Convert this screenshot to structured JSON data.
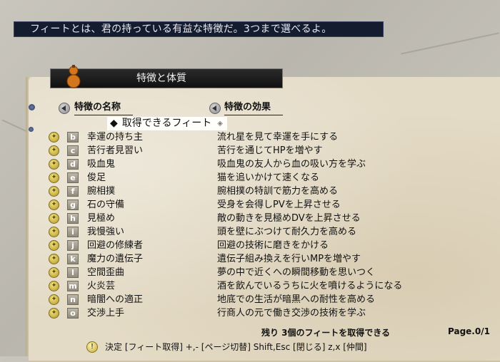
{
  "hint": "フィートとは、君の持っている有益な特徴だ。3つまで選べるよ。",
  "window_title": "特徴と体質",
  "columns": {
    "name": "特徴の名称",
    "effect": "特徴の効果"
  },
  "section_label": "取得できるフィート",
  "feats": [
    {
      "key": "b",
      "name": "幸運の持ち主",
      "effect": "流れ星を見て幸運を手にする"
    },
    {
      "key": "c",
      "name": "苦行者見習い",
      "effect": "苦行を通じてHPを増やす"
    },
    {
      "key": "d",
      "name": "吸血鬼",
      "effect": "吸血鬼の友人から血の吸い方を学ぶ"
    },
    {
      "key": "e",
      "name": "俊足",
      "effect": "猫を追いかけて速くなる"
    },
    {
      "key": "f",
      "name": "腕相撲",
      "effect": "腕相撲の特訓で筋力を高める"
    },
    {
      "key": "g",
      "name": "石の守備",
      "effect": "受身を会得しPVを上昇させる"
    },
    {
      "key": "h",
      "name": "見極め",
      "effect": "敵の動きを見極めDVを上昇させる"
    },
    {
      "key": "i",
      "name": "我慢強い",
      "effect": "頭を壁にぶつけて耐久力を高める"
    },
    {
      "key": "j",
      "name": "回避の修練者",
      "effect": "回避の技術に磨きをかける"
    },
    {
      "key": "k",
      "name": "魔力の遺伝子",
      "effect": "遺伝子組み換えを行いMPを増やす"
    },
    {
      "key": "l",
      "name": "空間歪曲",
      "effect": "夢の中で近くへの瞬間移動を思いつく"
    },
    {
      "key": "m",
      "name": "火炎芸",
      "effect": "酒を飲んでいるうちに火を噴けるようになる"
    },
    {
      "key": "n",
      "name": "暗闇への適正",
      "effect": "地底での生活が暗黒への耐性を高める"
    },
    {
      "key": "o",
      "name": "交渉上手",
      "effect": "行商人の元で働き交渉の技術を学ぶ"
    }
  ],
  "remaining": "残り 3個のフィートを取得できる",
  "page": "Page.0/1",
  "footer": "決定 [フィート取得]  +,- [ページ切替]  Shift,Esc [閉じる]  z,x [仲間]",
  "colors": {
    "hint_bg": "#141c30",
    "parchment": "#e4dbc6",
    "header_bg": "#111111"
  }
}
